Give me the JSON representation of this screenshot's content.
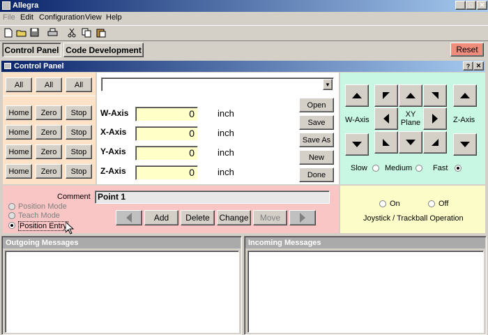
{
  "window": {
    "title": "Allegra"
  },
  "menu": [
    "File",
    "Edit",
    "Configuration",
    "View",
    "Help"
  ],
  "toolbar_icons": [
    "new-file-icon",
    "open-folder-icon",
    "save-disk-icon",
    "print-icon",
    "cut-icon",
    "copy-icon",
    "paste-icon"
  ],
  "tabs": {
    "control_panel": "Control Panel",
    "code_development": "Code Development"
  },
  "reset_label": "Reset",
  "panel": {
    "title": "Control Panel",
    "help": "?",
    "close": "✕"
  },
  "all_buttons": [
    "All",
    "All",
    "All"
  ],
  "axis_rows": [
    {
      "home": "Home",
      "zero": "Zero",
      "stop": "Stop",
      "label": "W-Axis",
      "value": "0",
      "unit": "inch"
    },
    {
      "home": "Home",
      "zero": "Zero",
      "stop": "Stop",
      "label": "X-Axis",
      "value": "0",
      "unit": "inch"
    },
    {
      "home": "Home",
      "zero": "Zero",
      "stop": "Stop",
      "label": "Y-Axis",
      "value": "0",
      "unit": "inch"
    },
    {
      "home": "Home",
      "zero": "Zero",
      "stop": "Stop",
      "label": "Z-Axis",
      "value": "0",
      "unit": "inch"
    }
  ],
  "file_dropdown": {
    "value": ""
  },
  "file_buttons": [
    "Open",
    "Save",
    "Save As",
    "New",
    "Done"
  ],
  "jog": {
    "w_axis_label": "W-Axis",
    "z_axis_label": "Z-Axis",
    "xy_plane_label": "XY Plane",
    "speeds": [
      "Slow",
      "Medium",
      "Fast"
    ],
    "selected_speed": "Fast"
  },
  "comment": {
    "label": "Comment",
    "value": "Point 1"
  },
  "modes": {
    "options": [
      "Position Mode",
      "Teach Mode",
      "Position Entry"
    ],
    "selected": "Position Entry"
  },
  "point_buttons": [
    "Add",
    "Delete",
    "Change",
    "Move"
  ],
  "joystick": {
    "on_label": "On",
    "off_label": "Off",
    "caption": "Joystick / Trackball Operation"
  },
  "messages": {
    "outgoing": "Outgoing Messages",
    "incoming": "Incoming Messages"
  }
}
